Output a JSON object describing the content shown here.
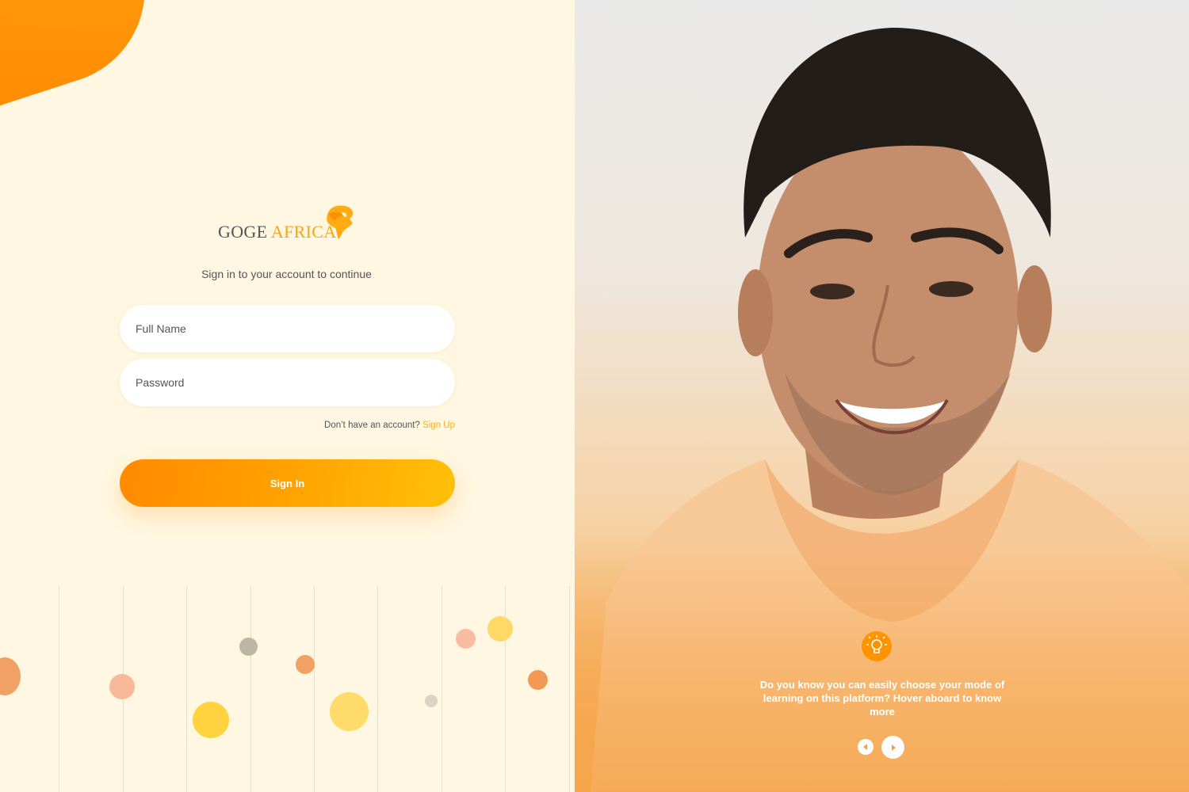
{
  "brand": {
    "name_part1": "GOGE",
    "name_part2": "AFRICA"
  },
  "login": {
    "subtitle": "Sign in to your account to continue",
    "full_name_placeholder": "Full Name",
    "password_placeholder": "Password",
    "no_account_text": "Don’t have an account?",
    "signup_link": "Sign Up",
    "signin_button": "Sign In"
  },
  "tip": {
    "icon": "lightbulb-icon",
    "text": "Do you know you can easily choose your mode of learning on this platform? Hover aboard to know more"
  },
  "colors": {
    "accent": "#ff9400",
    "accent_light": "#ffc107",
    "left_background": "#fff7e1",
    "link": "#f2b21b"
  }
}
